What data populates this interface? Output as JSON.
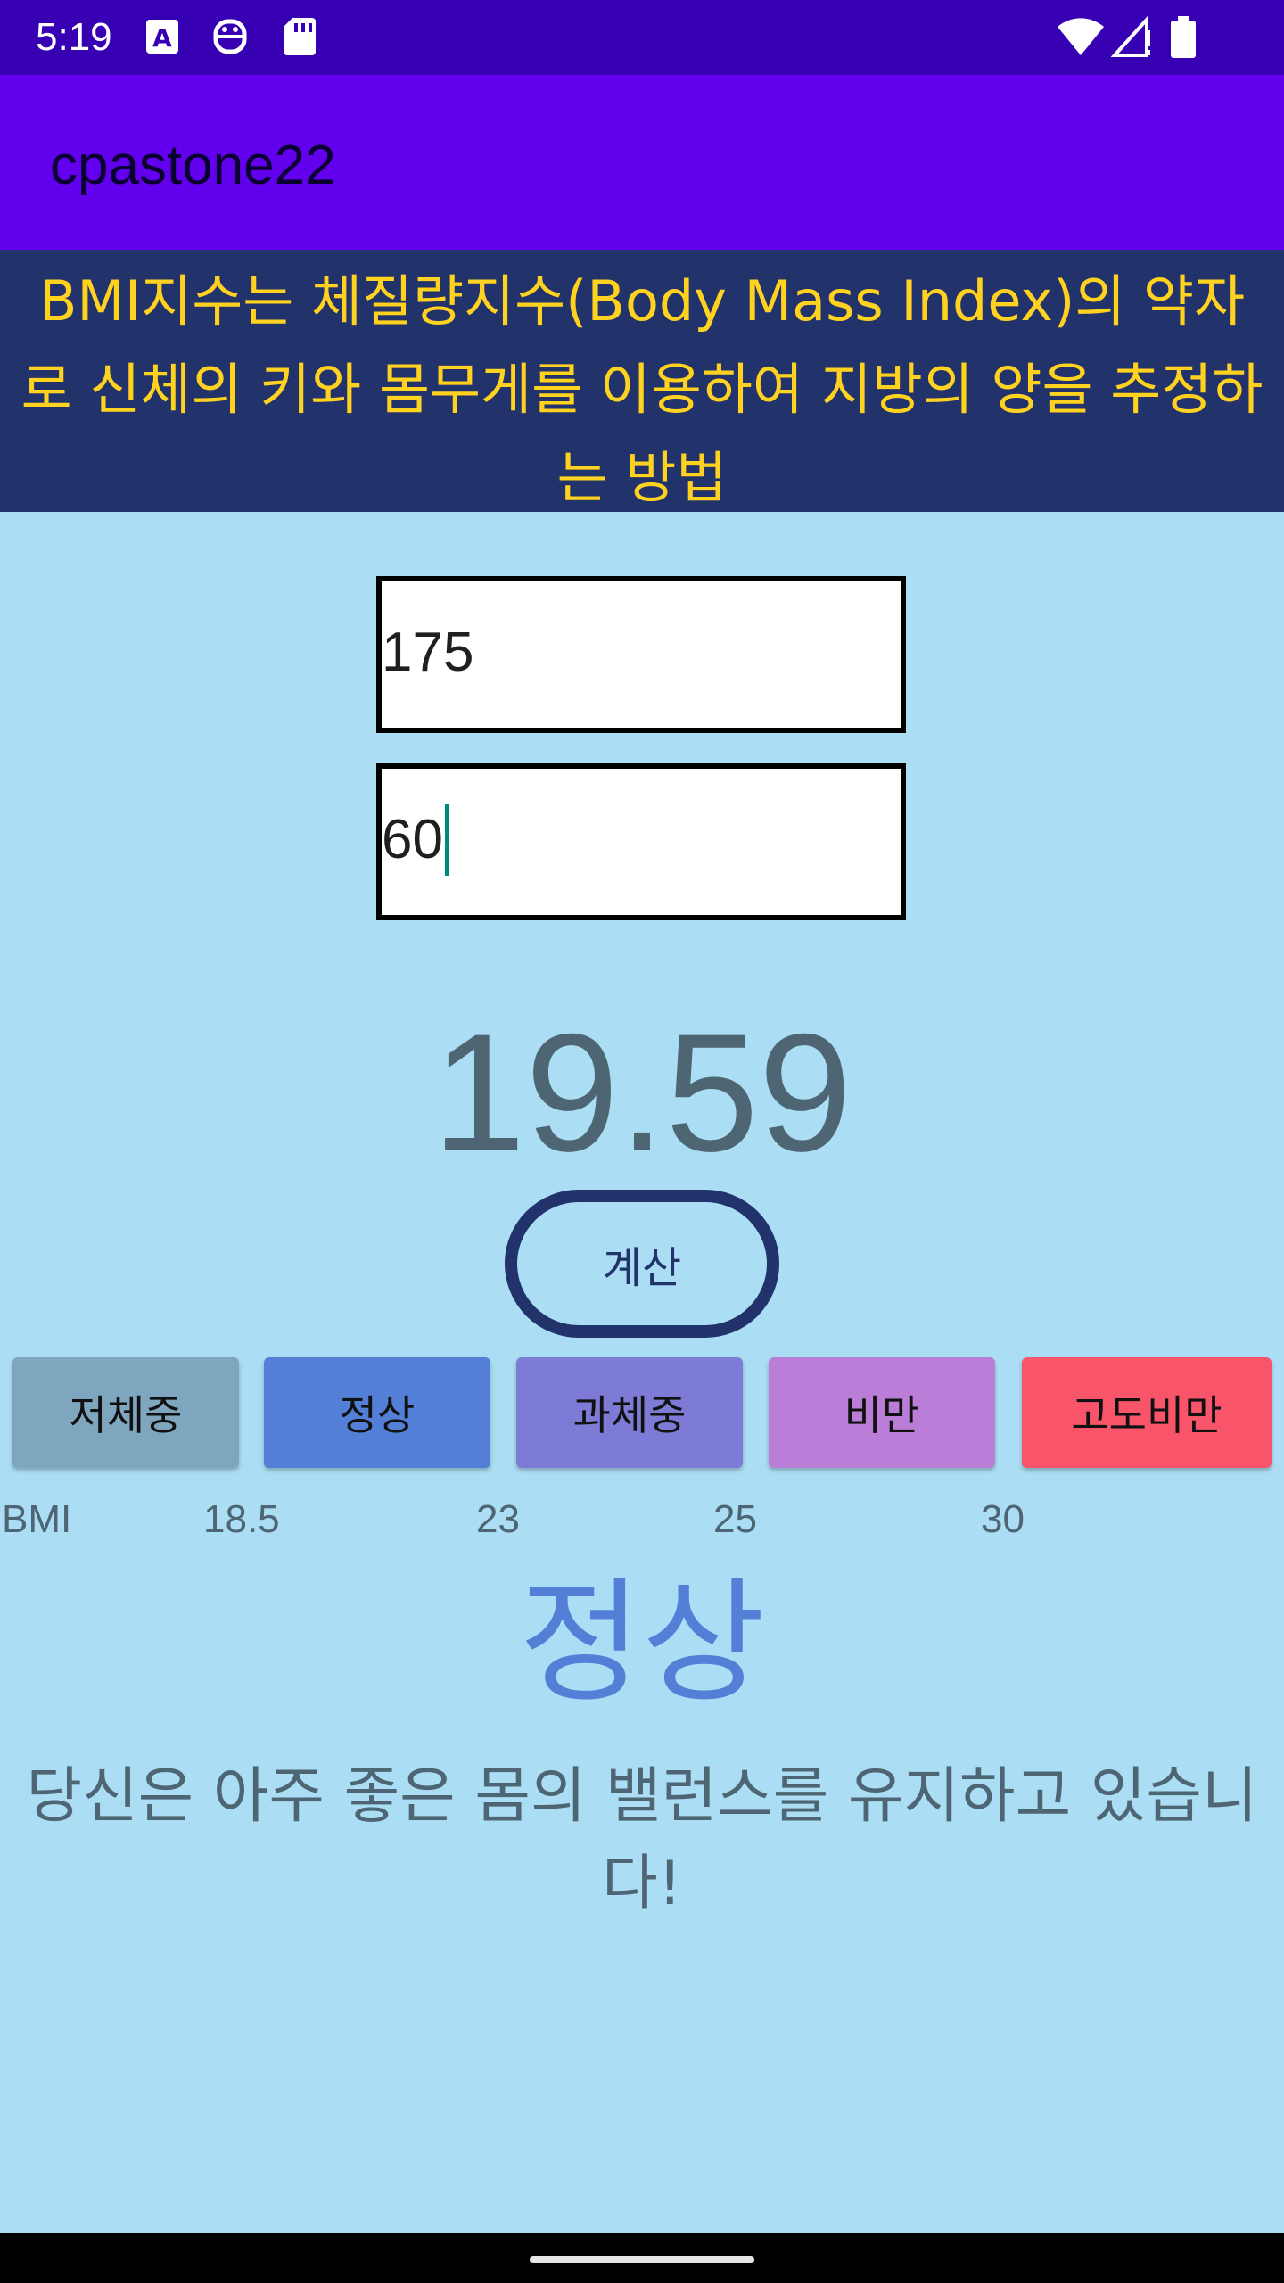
{
  "status_bar": {
    "time": "5:19",
    "icons": [
      "a-keyboard-icon",
      "robot-icon",
      "sd-card-icon",
      "wifi-icon",
      "signal-icon",
      "battery-icon"
    ]
  },
  "app_bar": {
    "title": "cpastone22"
  },
  "info_banner": {
    "text": "BMI지수는 체질량지수(Body Mass Index)의 약자로 신체의 키와 몸무게를 이용하여 지방의 양을 추정하는 방법"
  },
  "inputs": {
    "height_value": "175",
    "weight_value": "60"
  },
  "result": {
    "bmi_value": "19.59",
    "category_label": "정상",
    "message": "당신은 아주 좋은 몸의 밸런스를 유지하고 있습니다!"
  },
  "calc_button": {
    "label": "계산"
  },
  "categories": [
    {
      "label": "저체중",
      "color": "#7fa6bf"
    },
    {
      "label": "정상",
      "color": "#547fd6"
    },
    {
      "label": "과체중",
      "color": "#7e7bd6"
    },
    {
      "label": "비만",
      "color": "#ba7ed8"
    },
    {
      "label": "고도비만",
      "color": "#f8546a"
    }
  ],
  "scale": {
    "labels": [
      "BMI",
      "18.5",
      "23",
      "25",
      "30"
    ]
  },
  "colors": {
    "status_bar": "#3700b3",
    "app_bar": "#6200ee",
    "banner": "#22326b",
    "banner_text": "#ffd21f",
    "background": "#abdef4",
    "result_label": "#547fd6"
  }
}
